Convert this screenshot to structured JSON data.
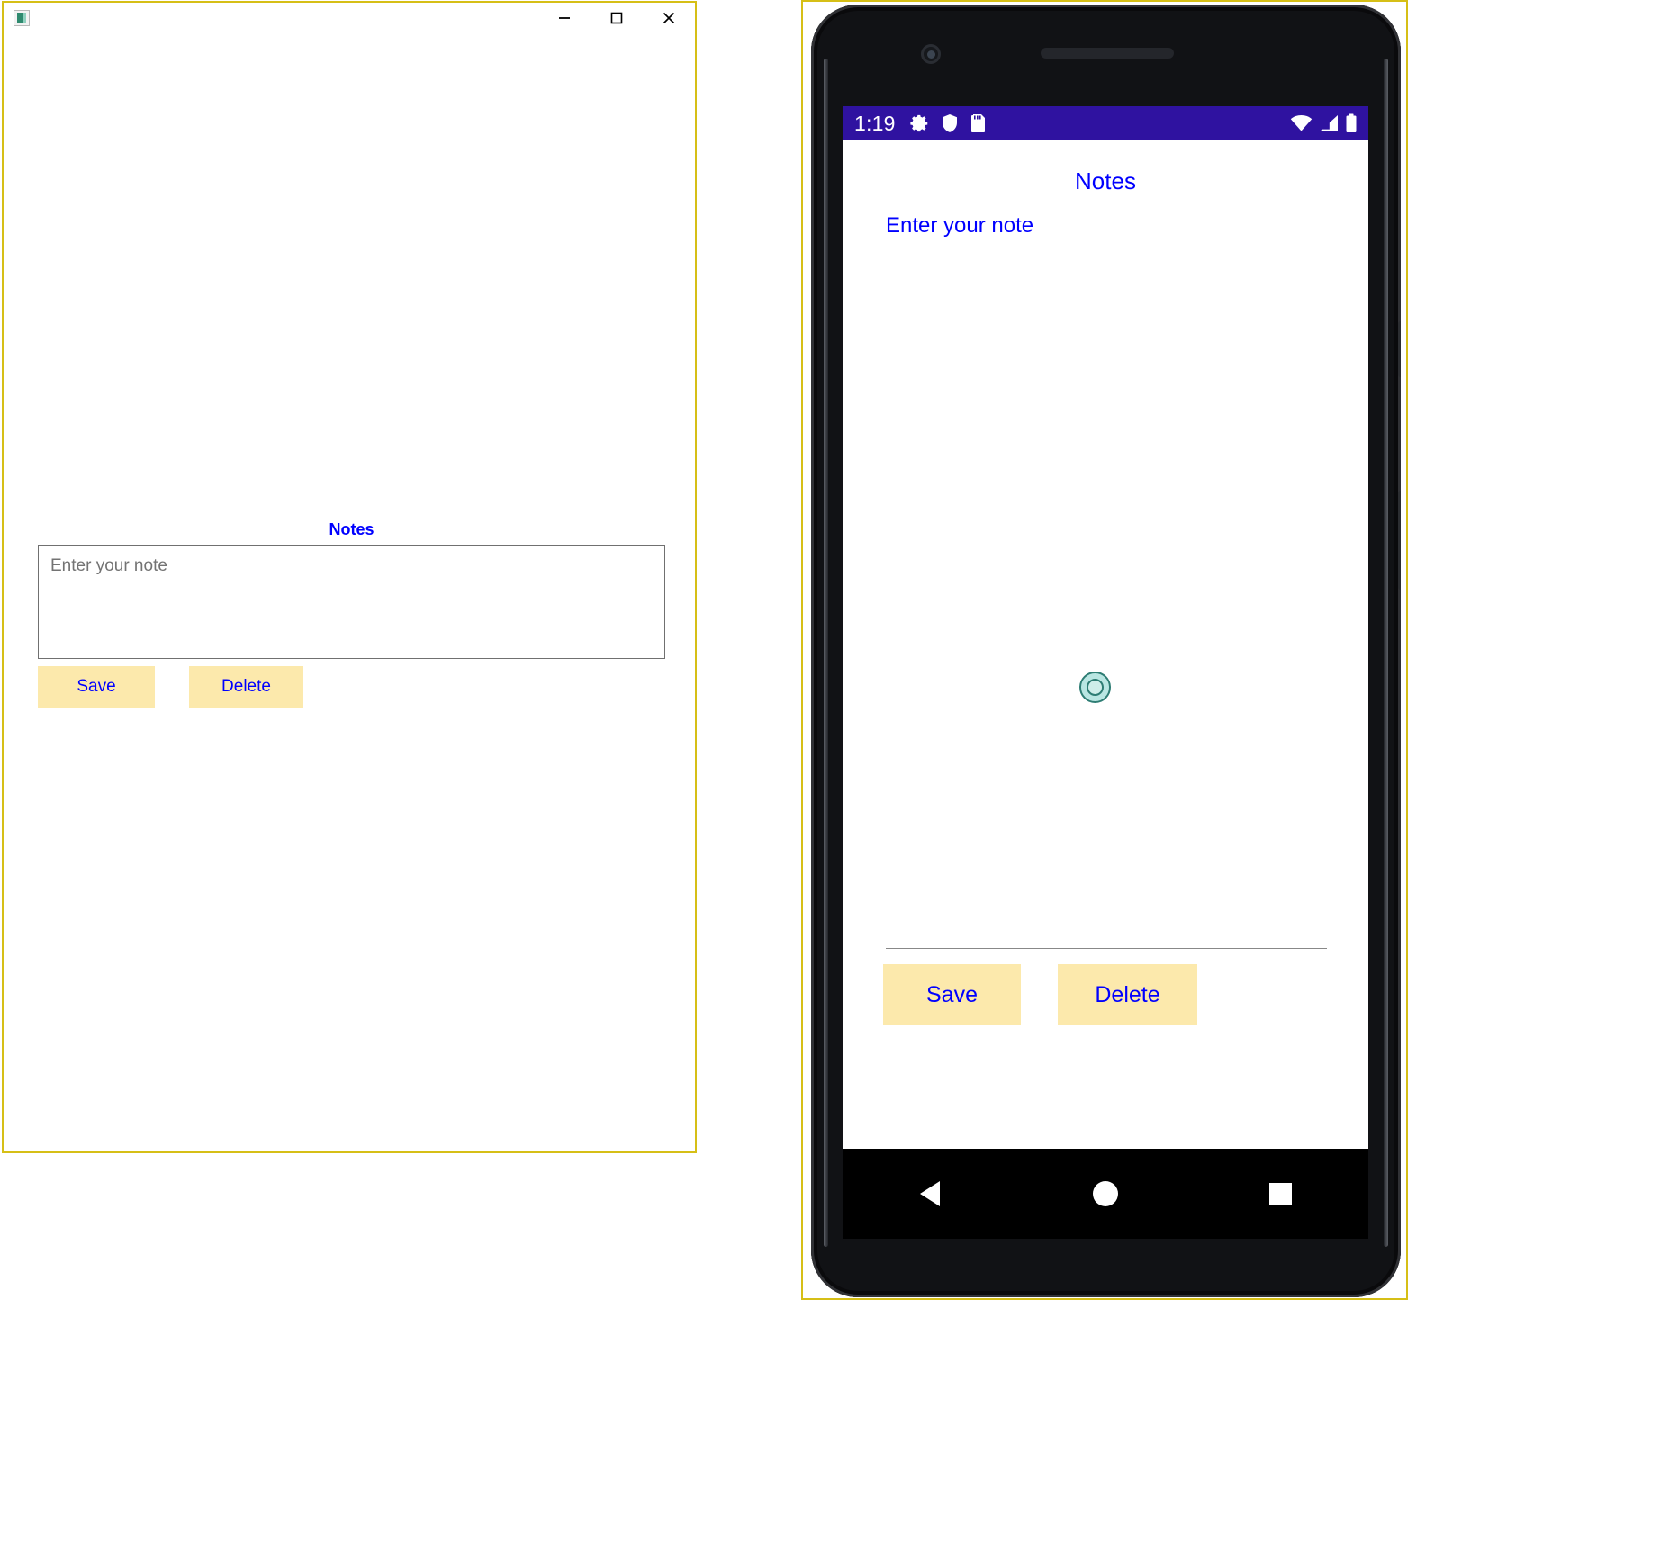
{
  "desktop_window": {
    "app_icon_name": "notes-app-icon",
    "window_controls": {
      "minimize_label": "Minimize",
      "maximize_label": "Maximize",
      "close_label": "Close"
    },
    "notes_title": "Notes",
    "note_input": {
      "value": "",
      "placeholder": "Enter your note"
    },
    "buttons": {
      "save_label": "Save",
      "delete_label": "Delete"
    },
    "colors": {
      "window_border": "#d6bf16",
      "accent_text": "#0000ff",
      "button_bg": "#fce9ac",
      "placeholder": "#737373",
      "input_border": "#707070"
    }
  },
  "phone": {
    "status_bar": {
      "time": "1:19",
      "left_icons": [
        "gear-icon",
        "shield-icon",
        "sd-card-icon"
      ],
      "right_icons": [
        "wifi-icon",
        "cellular-signal-icon",
        "battery-icon"
      ],
      "background_color": "#2f12a0",
      "text_color": "#ffffff"
    },
    "screen": {
      "notes_title": "Notes",
      "enter_note_label": "Enter your note",
      "touch_indicator_name": "touch-pointer-indicator",
      "buttons": {
        "save_label": "Save",
        "delete_label": "Delete"
      }
    },
    "nav_bar": {
      "back_label": "Back",
      "home_label": "Home",
      "recents_label": "Recent apps"
    },
    "hardware": {
      "camera_name": "front-camera",
      "speaker_name": "earpiece-speaker"
    },
    "colors": {
      "bezel": "#111215",
      "outline": "#d6bf16",
      "accent_text": "#0000ff",
      "button_bg": "#fce9ac",
      "nav_bar_bg": "#000000",
      "touch_indicator": "#b9e6e2"
    }
  }
}
